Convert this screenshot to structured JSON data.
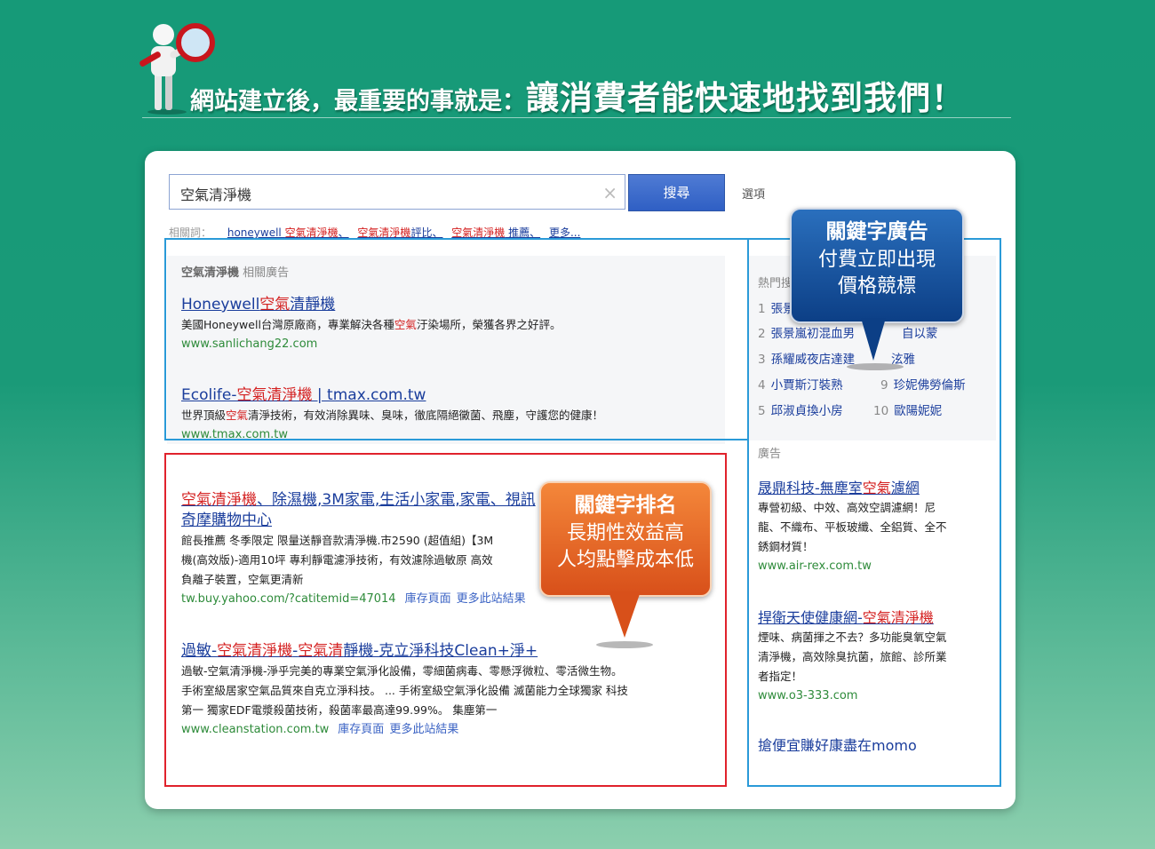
{
  "banner": {
    "lead": "網站建立後，最重要的事就是：",
    "main": "讓消費者能快速地找到我們！"
  },
  "search": {
    "query": "空氣清淨機",
    "clear_icon": "×",
    "button_label": "搜尋",
    "options_label": "選項"
  },
  "related": {
    "label": "相關詞：",
    "links": [
      {
        "prefix": "honeywell ",
        "kw": "空氣清淨機",
        "suffix": "、"
      },
      {
        "prefix": "",
        "kw": "空氣清淨機",
        "suffix": "評比、"
      },
      {
        "prefix": "",
        "kw": "空氣清淨機",
        "suffix": " 推薦、"
      },
      {
        "prefix": "更多...",
        "kw": "",
        "suffix": ""
      }
    ]
  },
  "top_ads": {
    "heading_kw": "空氣清淨機",
    "heading_rest": " 相關廣告",
    "items": [
      {
        "title_pre": "Honeywell",
        "title_kw": "空氣",
        "title_post": "清靜機",
        "desc_pre": "美國Honeywell台灣原廠商，專業解決各種",
        "desc_kw": "空氣",
        "desc_post": "汙染場所，榮獲各界之好評。",
        "url": "www.sanlichang22.com"
      },
      {
        "title_pre": "Ecolife-",
        "title_kw": "空氣清淨機",
        "title_post": " | tmax.com.tw",
        "desc_pre": "世界頂級",
        "desc_kw": "空氣",
        "desc_post": "清淨技術，有效消除異味、臭味，徹底隔絕黴菌、飛塵，守護您的健康！",
        "url": "www.tmax.com.tw"
      }
    ]
  },
  "organic": [
    {
      "title_kw": "空氣清淨機",
      "title_post": "、除濕機,3M家電,生活小家電,家電、視訊",
      "title_line2": "奇摩購物中心",
      "desc_lines": [
        "館長推薦 冬季限定 限量送靜音款清淨機.市2590 (超值組)【3M",
        "機(高效版)-適用10坪 專利靜電濾淨技術，有效濾除過敏原 高效",
        "負離子裝置，空氣更清新"
      ],
      "url": "tw.buy.yahoo.com/?catitemid=47014",
      "cache": "庫存頁面",
      "more": "更多此站結果"
    },
    {
      "title_pre": "過敏-",
      "title_kw": "空氣清淨機",
      "title_mid": "-",
      "title_kw2": "空氣清",
      "title_post": "靜機-克立淨科技Clean+淨+",
      "desc_lines": [
        "過敏-空氣清淨機-淨乎完美的專業空氣淨化設備，零細菌病毒、零懸浮微粒、零活微生物。",
        "手術室級居家空氣品質來自克立淨科技。 ... 手術室級空氣淨化設備 滅菌能力全球獨家 科技",
        "第一 獨家EDF電漿殺菌技術，殺菌率最高達99.99%。 集塵第一"
      ],
      "url": "www.cleanstation.com.tw",
      "cache": "庫存頁面",
      "more": "更多此站結果"
    }
  ],
  "hot": {
    "heading": "熱門搜",
    "items": [
      {
        "num": "1",
        "text": "張景"
      },
      {
        "num": "2",
        "text": "張景嵐初混血男"
      },
      {
        "num": "3",
        "text": "孫耀威夜店達建"
      },
      {
        "num": "4",
        "text": "小賈斯汀裝熟"
      },
      {
        "num": "5",
        "text": "邱淑貞換小房"
      },
      {
        "num": "9",
        "text": "珍妮佛勞倫斯"
      },
      {
        "num": "10",
        "text": "歐陽妮妮"
      },
      {
        "num": "",
        "text": "泫雅"
      },
      {
        "num": "",
        "text": "自以蒙"
      }
    ]
  },
  "side_ads": {
    "heading": "廣告",
    "items": [
      {
        "title_pre": "晟鼎科技-無塵室",
        "title_kw": "空氣",
        "title_post": "濾網",
        "desc": [
          "專營初級、中效、高效空調濾網！尼",
          "龍、不織布、平板玻纖、全鋁質、全不",
          "銹鋼材質！"
        ],
        "url": "www.air-rex.com.tw"
      },
      {
        "title_pre": "捍衛天使健康網-",
        "title_kw": "空氣清淨機",
        "title_post": "",
        "desc": [
          "煙味、病菌揮之不去？多功能臭氧空氣",
          "清淨機，高效除臭抗菌，旅館、診所業",
          "者指定！"
        ],
        "url": "www.o3-333.com"
      },
      {
        "title_pre": "搶便宜賺好康盡在momo",
        "title_kw": "",
        "title_post": "",
        "desc": [],
        "url": ""
      }
    ]
  },
  "callouts": {
    "ad": {
      "title": "關鍵字廣告",
      "line1": "付費立即出現",
      "line2": "價格競標"
    },
    "rank": {
      "title": "關鍵字排名",
      "line1": "長期性效益高",
      "line2": "人均點擊成本低"
    }
  },
  "colors": {
    "background": "#169a78",
    "frame_blue": "#2a9ad8",
    "frame_red": "#e0222c",
    "link": "#1a3d9c",
    "keyword": "#d42020",
    "url": "#2e8b3a"
  }
}
